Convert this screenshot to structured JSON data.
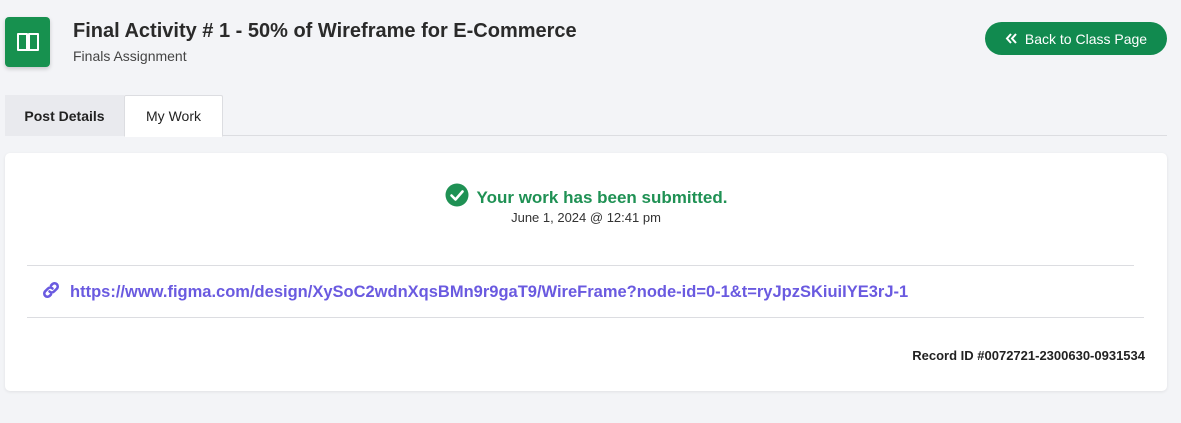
{
  "header": {
    "title": "Final Activity # 1 - 50% of Wireframe for E-Commerce",
    "subtitle": "Finals Assignment",
    "icon": "open-book-icon",
    "back_button": {
      "label": "Back to Class Page",
      "icon": "double-chevron-left-icon"
    }
  },
  "tabs": [
    {
      "label": "Post Details",
      "active": false
    },
    {
      "label": "My Work",
      "active": true
    }
  ],
  "submission": {
    "status_text": "Your work has been submitted.",
    "status_icon": "check-circle-icon",
    "date": "June 1, 2024 @ 12:41 pm",
    "link_icon": "link-icon",
    "link": "https://www.figma.com/design/XySoC2wdnXqsBMn9r9gaT9/WireFrame?node-id=0-1&t=ryJpzSKiuiIYE3rJ-1",
    "record_id": "Record ID #0072721-2300630-0931534"
  },
  "colors": {
    "brand_green": "#118a4f",
    "success_green": "#1f9154",
    "link_purple": "#6a5ae0",
    "page_bg": "#f3f4f7"
  }
}
